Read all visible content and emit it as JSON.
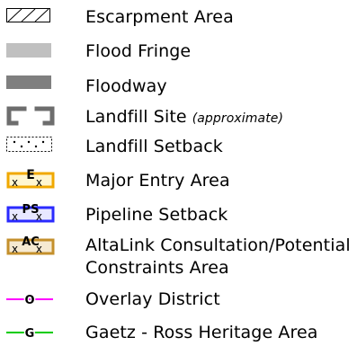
{
  "legend": {
    "items": [
      {
        "label": "Escarpment Area",
        "icon": "escarpment-hatch-icon"
      },
      {
        "label": "Flood Fringe",
        "icon": "flood-fringe-swatch-icon",
        "color": "#c0c0c0"
      },
      {
        "label": "Floodway",
        "icon": "floodway-swatch-icon",
        "color": "#7f7f7f"
      },
      {
        "label": "Landfill Site",
        "note": "(approximate)",
        "icon": "landfill-site-bracket-icon",
        "color": "#6d6d6d"
      },
      {
        "label": "Landfill Setback",
        "icon": "landfill-setback-dotted-icon"
      },
      {
        "label": "Major Entry Area",
        "icon": "major-entry-area-icon",
        "symbol_text": "E",
        "marks": "x x",
        "color": "#f0a800",
        "fill": "#fff6d0"
      },
      {
        "label": "Pipeline Setback",
        "icon": "pipeline-setback-icon",
        "symbol_text": "PS",
        "marks": "x x",
        "color": "#2a2aff",
        "fill": "#e8e8ff"
      },
      {
        "label": "AltaLink Consultation/Potential",
        "label_line2": "Constraints Area",
        "icon": "altalink-area-icon",
        "symbol_text": "AC",
        "marks": "x x",
        "color": "#c4902c",
        "fill": "#f6ead2"
      },
      {
        "label": "Overlay District",
        "icon": "overlay-district-line-icon",
        "symbol_text": "O",
        "color": "#ff00ff"
      },
      {
        "label": "Gaetz - Ross Heritage Area",
        "icon": "heritage-area-line-icon",
        "symbol_text": "G",
        "color": "#00cc00"
      }
    ]
  }
}
